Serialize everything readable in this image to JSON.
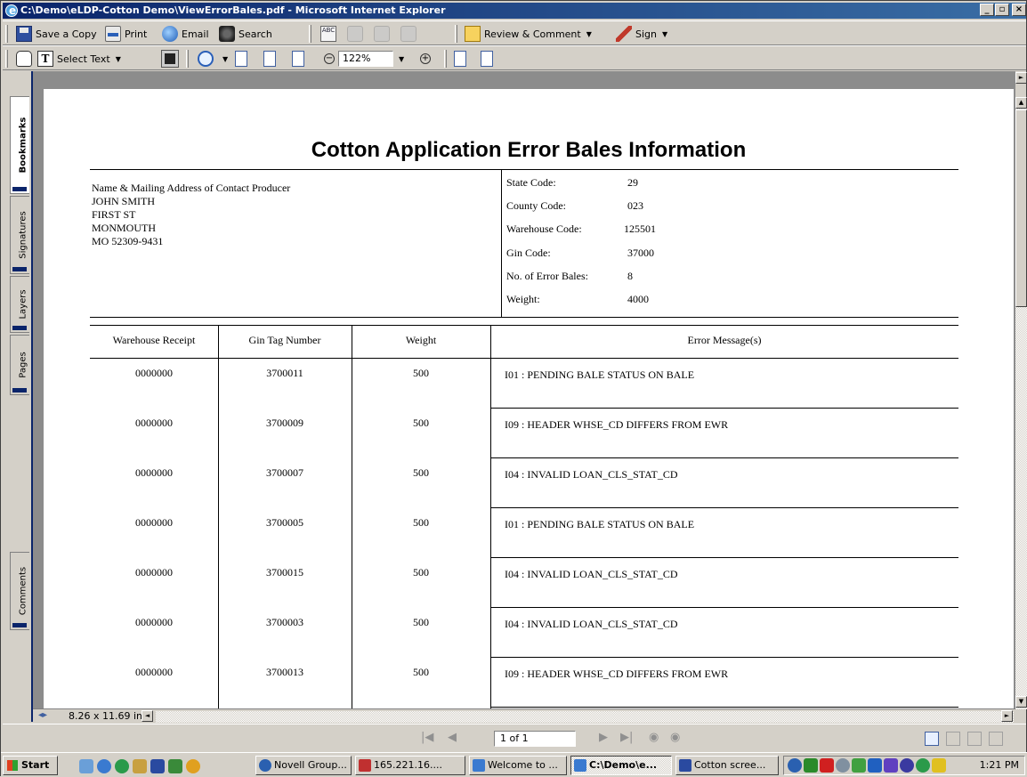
{
  "window": {
    "title": "C:\\Demo\\eLDP-Cotton Demo\\ViewErrorBales.pdf - Microsoft Internet Explorer",
    "controls": [
      "_",
      "▫",
      "×"
    ]
  },
  "toolbar1": {
    "save_copy": "Save a Copy",
    "print": "Print",
    "email": "Email",
    "search": "Search",
    "review_comment": "Review & Comment",
    "sign": "Sign"
  },
  "toolbar2": {
    "select_text": "Select Text",
    "zoom_value": "122%"
  },
  "nav_tabs": {
    "bookmarks": "Bookmarks",
    "signatures": "Signatures",
    "layers": "Layers",
    "pages": "Pages",
    "comments": "Comments"
  },
  "document": {
    "title": "Cotton Application Error Bales Information",
    "address_label": "Name & Mailing Address of Contact Producer",
    "address_lines": [
      "JOHN SMITH",
      "FIRST ST",
      "MONMOUTH",
      "MO 52309-9431"
    ],
    "info": [
      {
        "label": "State Code:",
        "value": "29"
      },
      {
        "label": "County Code:",
        "value": "023"
      },
      {
        "label": "Warehouse Code:",
        "value": "125501"
      },
      {
        "label": "Gin Code:",
        "value": "37000"
      },
      {
        "label": "No. of Error Bales:",
        "value": "8"
      },
      {
        "label": "Weight:",
        "value": "4000"
      }
    ],
    "columns": [
      "Warehouse Receipt",
      "Gin Tag Number",
      "Weight",
      "Error Message(s)"
    ],
    "rows": [
      [
        "0000000",
        "3700011",
        "500",
        "I01 :  PENDING BALE STATUS ON BALE"
      ],
      [
        "0000000",
        "3700009",
        "500",
        "I09 :  HEADER WHSE_CD DIFFERS FROM EWR"
      ],
      [
        "0000000",
        "3700007",
        "500",
        "I04 :  INVALID LOAN_CLS_STAT_CD"
      ],
      [
        "0000000",
        "3700005",
        "500",
        "I01 :  PENDING BALE STATUS ON BALE"
      ],
      [
        "0000000",
        "3700015",
        "500",
        "I04 :  INVALID LOAN_CLS_STAT_CD"
      ],
      [
        "0000000",
        "3700003",
        "500",
        "I04 :  INVALID LOAN_CLS_STAT_CD"
      ],
      [
        "0000000",
        "3700013",
        "500",
        "I09 :  HEADER WHSE_CD DIFFERS FROM EWR"
      ]
    ]
  },
  "footer": {
    "page_size": "8.26 x 11.69 in",
    "page_indicator": "1 of 1"
  },
  "taskbar": {
    "start": "Start",
    "tasks": [
      "Novell Group...",
      "165.221.16....",
      "Welcome to ...",
      "C:\\Demo\\e...",
      "Cotton scree..."
    ],
    "clock": "1:21 PM"
  }
}
